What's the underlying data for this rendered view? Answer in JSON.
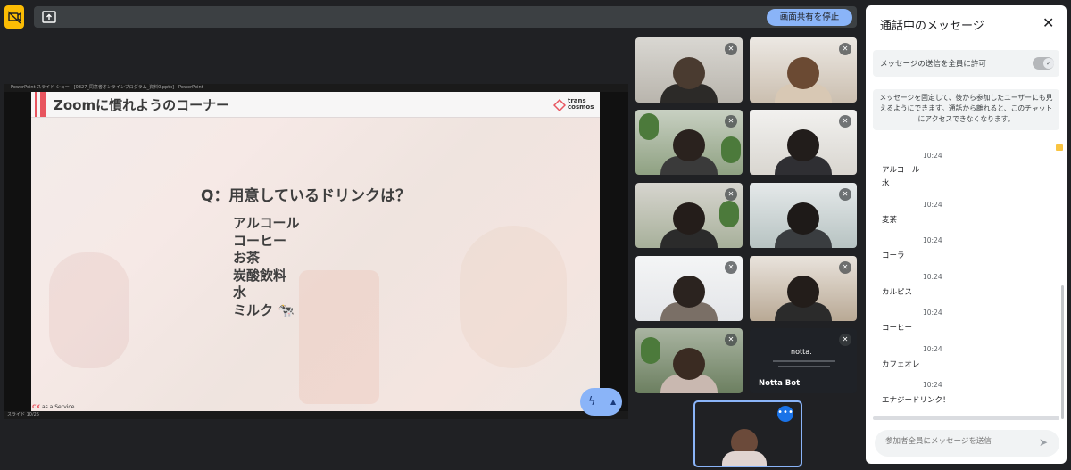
{
  "top_bar": {
    "stop_share_label": "画面共有を停止"
  },
  "presentation": {
    "window_title": "PowerPoint スライド ショー - [0327_同意者オンラインプログラム_資料0.pptx] - PowerPoint",
    "slide_heading": "Zoomに慣れようのコーナー",
    "logo_text": "trans cosmos",
    "question": "Q：用意しているドリンクは？",
    "drinks": [
      "アルコール",
      "コーヒー",
      "お茶",
      "炭酸飲料",
      "水",
      "ミルク 🐄"
    ],
    "footer_brand_cx": "CX",
    "footer_brand_rest": " as a Service",
    "slide_status": "スライド 10/25"
  },
  "participants": {
    "notta_logo": "notta.",
    "notta_name": "Notta Bot"
  },
  "chat": {
    "title": "通話中のメッセージ",
    "allow_label": "メッセージの送信を全員に許可",
    "pin_info": "メッセージを固定して、後から参加したユーザーにも見えるようにできます。通話から離れると、このチャットにアクセスできなくなります。",
    "messages": [
      {
        "time": "10:24",
        "lines": [
          "アルコール",
          "水"
        ]
      },
      {
        "time": "10:24",
        "lines": [
          "麦茶"
        ]
      },
      {
        "time": "10:24",
        "lines": [
          "コーラ"
        ]
      },
      {
        "time": "10:24",
        "lines": [
          "カルピス"
        ]
      },
      {
        "time": "10:24",
        "lines": [
          "コーヒー"
        ]
      },
      {
        "time": "10:24",
        "lines": [
          "カフェオレ"
        ]
      },
      {
        "time": "10:24",
        "lines": [
          "エナジードリンク！"
        ]
      }
    ],
    "input_placeholder": "参加者全員にメッセージを送信"
  },
  "colors": {
    "accent": "#8ab4f8",
    "warn": "#fbbc04",
    "slide_accent": "#e8555f"
  }
}
